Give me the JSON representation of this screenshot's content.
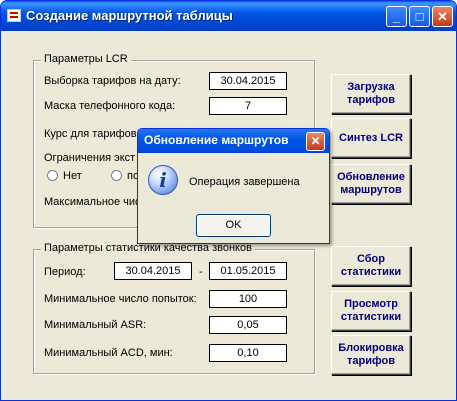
{
  "window": {
    "title": "Создание маршрутной таблицы",
    "minimize_glyph": "_",
    "maximize_glyph": "□",
    "close_glyph": "✕"
  },
  "lcr": {
    "legend": "Параметры  LCR",
    "date_label": "Выборка тарифов на дату:",
    "date_value": "30.04.2015",
    "mask_label": "Маска телефонного кода:",
    "mask_value": "7",
    "rate_label": "Курс для тарифов",
    "limit_label": "Ограничения экст",
    "radio_no": "Нет",
    "radio_other": "по",
    "max_label": "Максимальное чис"
  },
  "stats": {
    "legend": "Параметры статистики качества звонков",
    "period_label": "Период:",
    "period_from": "30.04.2015",
    "period_dash": "-",
    "period_to": "01.05.2015",
    "min_attempts_label": "Минимальное число попыток:",
    "min_attempts_value": "100",
    "min_asr_label": "Минимальный ASR:",
    "min_asr_value": "0,05",
    "min_acd_label": "Минимальный ACD, мин:",
    "min_acd_value": "0,10"
  },
  "buttons": {
    "load": "Загрузка тарифов",
    "synth": "Синтез LCR",
    "update": "Обновление маршрутов",
    "collect": "Сбор статистики",
    "view": "Просмотр статистики",
    "block": "Блокировка тарифов"
  },
  "dialog": {
    "title": "Обновление маршрутов",
    "close_glyph": "✕",
    "icon": "info-icon",
    "icon_glyph": "i",
    "message": "Операция завершена",
    "ok": "OK"
  },
  "colors": {
    "titlebar": "#0055e5",
    "button_text": "#000080",
    "face": "#ece9d8"
  }
}
